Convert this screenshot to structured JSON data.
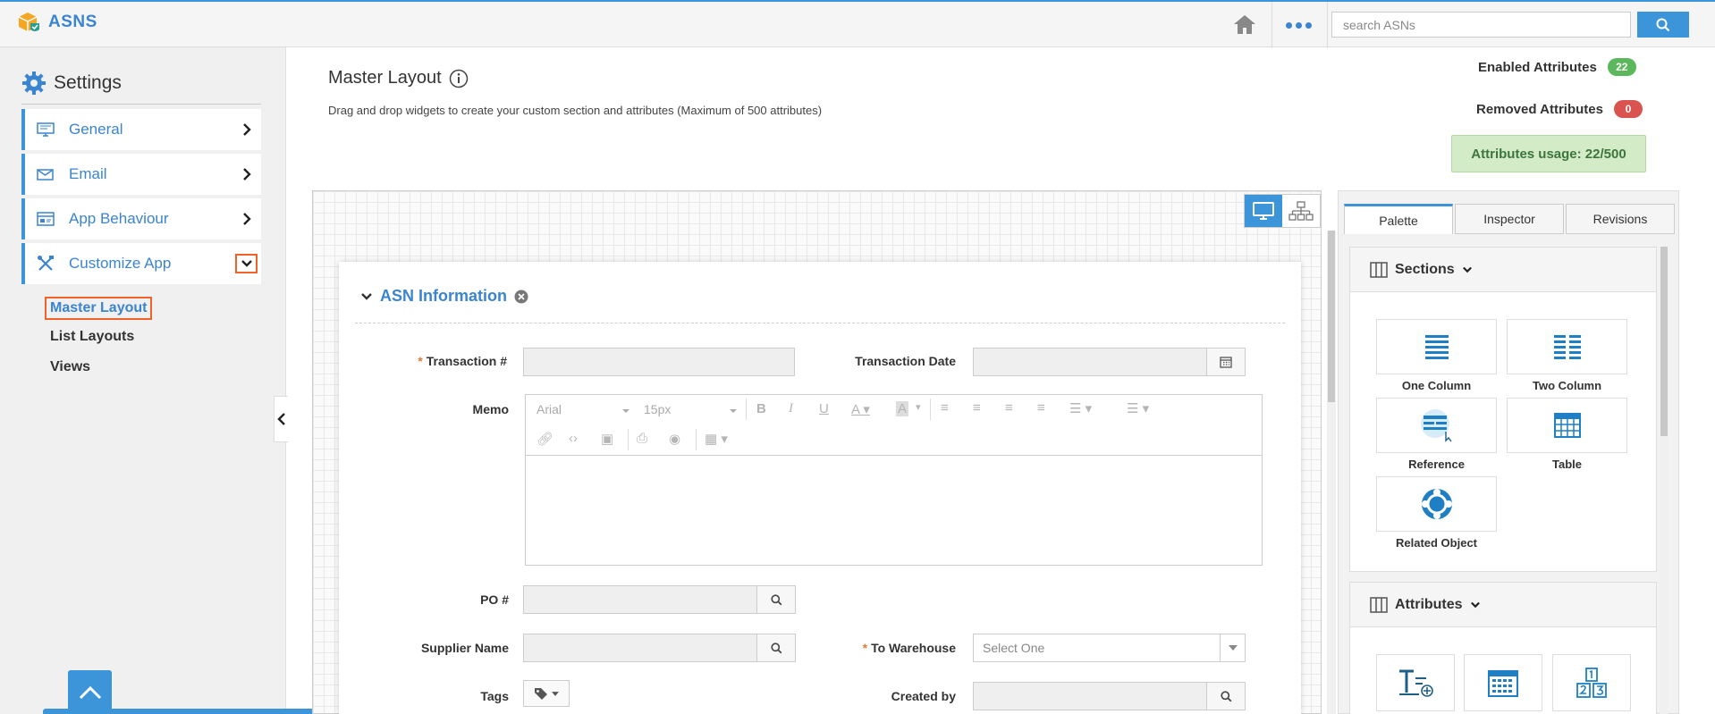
{
  "app": {
    "name": "ASNS"
  },
  "header": {
    "search_placeholder": "search ASNs"
  },
  "sidebar": {
    "title": "Settings",
    "items": [
      {
        "label": "General"
      },
      {
        "label": "Email"
      },
      {
        "label": "App Behaviour"
      },
      {
        "label": "Customize App"
      }
    ],
    "subitems": [
      {
        "label": "Master Layout"
      },
      {
        "label": "List Layouts"
      },
      {
        "label": "Views"
      }
    ]
  },
  "main": {
    "title": "Master Layout",
    "description": "Drag and drop widgets to create your custom section and attributes (Maximum of 500 attributes)",
    "enabled_label": "Enabled Attributes",
    "enabled_count": "22",
    "removed_label": "Removed Attributes",
    "removed_count": "0",
    "usage": "Attributes usage: 22/500"
  },
  "form": {
    "section_title": "ASN Information",
    "fields": {
      "transaction_no": "Transaction #",
      "transaction_date": "Transaction Date",
      "memo": "Memo",
      "po_no": "PO #",
      "supplier_name": "Supplier Name",
      "to_warehouse": "To Warehouse",
      "to_warehouse_value": "Select One",
      "tags": "Tags",
      "created_by": "Created by"
    },
    "editor": {
      "font": "Arial",
      "size": "15px"
    }
  },
  "panel": {
    "tabs": [
      {
        "label": "Palette"
      },
      {
        "label": "Inspector"
      },
      {
        "label": "Revisions"
      }
    ],
    "sections_title": "Sections",
    "widgets": [
      {
        "label": "One Column"
      },
      {
        "label": "Two Column"
      },
      {
        "label": "Reference"
      },
      {
        "label": "Table"
      },
      {
        "label": "Related Object"
      }
    ],
    "attributes_title": "Attributes"
  },
  "colors": {
    "accent": "#3b95d8",
    "highlight": "#f0622a",
    "success": "#5cb85c",
    "danger": "#d9534f"
  }
}
